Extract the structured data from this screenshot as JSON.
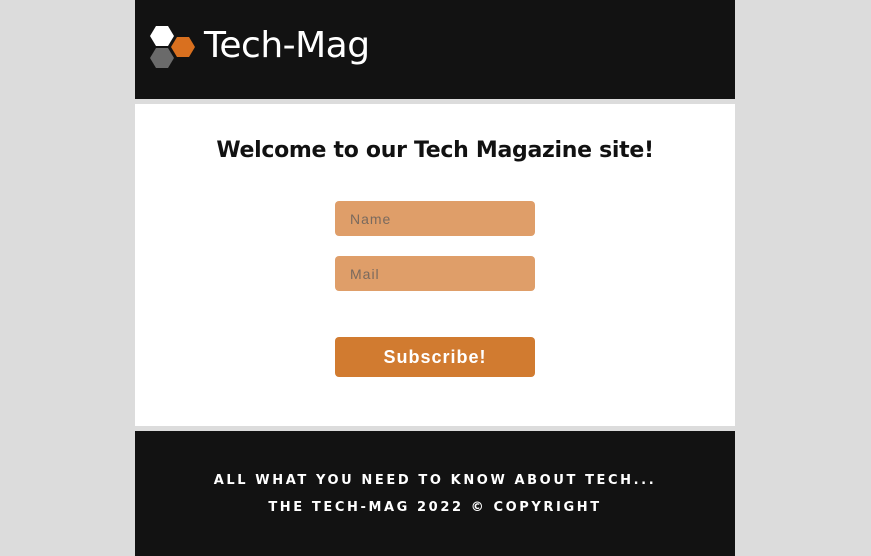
{
  "header": {
    "logo_text": "Tech-Mag",
    "logo_icon": "hexagon-cluster-icon"
  },
  "main": {
    "title": "Welcome to our Tech Magazine site!",
    "name_placeholder": "Name",
    "mail_placeholder": "Mail",
    "subscribe_label": "Subscribe!"
  },
  "footer": {
    "line1": "ALL WHAT YOU NEED TO KNOW ABOUT TECH...",
    "line2": "THE TECH-MAG 2022 © COPYRIGHT"
  },
  "colors": {
    "background": "#dcdcdc",
    "dark": "#121212",
    "input": "#df9e69",
    "accent": "#d17b30"
  }
}
